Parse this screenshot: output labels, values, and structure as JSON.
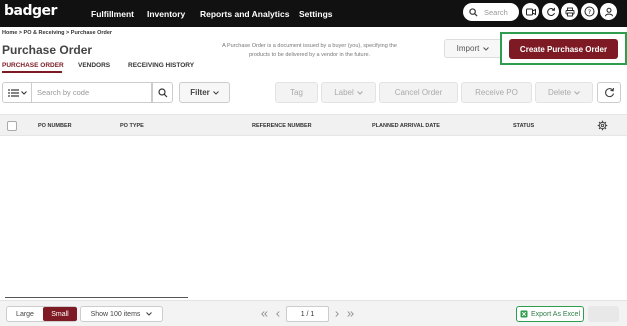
{
  "brand": {
    "logo_text": "badger"
  },
  "nav": {
    "items": [
      "Fulfillment",
      "Inventory",
      "Reports and Analytics",
      "Settings"
    ]
  },
  "search": {
    "placeholder": "Search"
  },
  "breadcrumb": "Home > PO & Receiving > Purchase Order",
  "page": {
    "title": "Purchase Order",
    "description": "A Purchase Order is a document issued by a buyer (you), specifying the products to be delivered by a vendor in the future.",
    "import_label": "Import",
    "create_label": "Create Purchase Order"
  },
  "tabs": [
    {
      "label": "PURCHASE ORDER",
      "active": true
    },
    {
      "label": "VENDORS",
      "active": false
    },
    {
      "label": "RECEIVING HISTORY",
      "active": false
    }
  ],
  "toolbar": {
    "search_placeholder": "Search by code",
    "filter_label": "Filter",
    "tag_label": "Tag",
    "label_label": "Label",
    "cancel_order_label": "Cancel Order",
    "receive_po_label": "Receive PO",
    "delete_label": "Delete"
  },
  "table": {
    "columns": [
      "PO NUMBER",
      "PO TYPE",
      "REFERENCE NUMBER",
      "PLANNED ARRIVAL DATE",
      "STATUS"
    ],
    "rows": []
  },
  "footer": {
    "size_large": "Large",
    "size_small": "Small",
    "show_items": "Show 100 items",
    "page_indicator": "1 / 1",
    "export_label": "Export As Excel"
  },
  "colors": {
    "brand": "#7d1a23",
    "highlight": "#2e9d4d",
    "topbar": "#111111"
  }
}
